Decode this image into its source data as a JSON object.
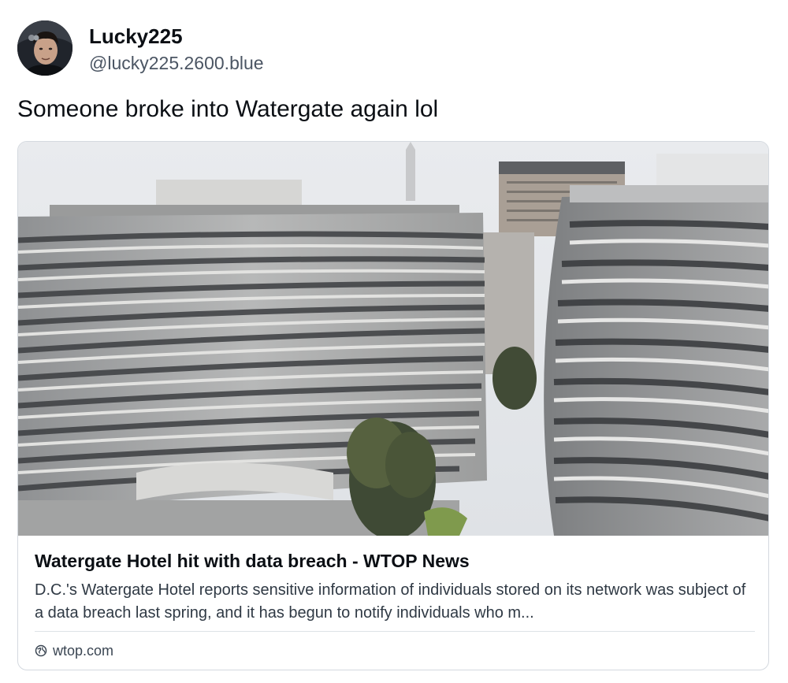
{
  "author": {
    "display_name": "Lucky225",
    "handle": "@lucky225.2600.blue",
    "avatar_icon": "user-avatar-photo"
  },
  "post": {
    "text": "Someone broke into Watergate again lol"
  },
  "link_card": {
    "image_icon": "watergate-complex-photo",
    "title": "Watergate Hotel hit with data breach - WTOP News",
    "description": "D.C.'s Watergate Hotel reports sensitive information of individuals stored on its network was subject of a data breach last spring, and it has begun to notify individuals who m...",
    "domain": "wtop.com",
    "domain_icon": "globe-icon"
  },
  "colors": {
    "text_primary": "#0b0f14",
    "text_secondary": "#4b5563",
    "card_border": "#d4d9df"
  }
}
